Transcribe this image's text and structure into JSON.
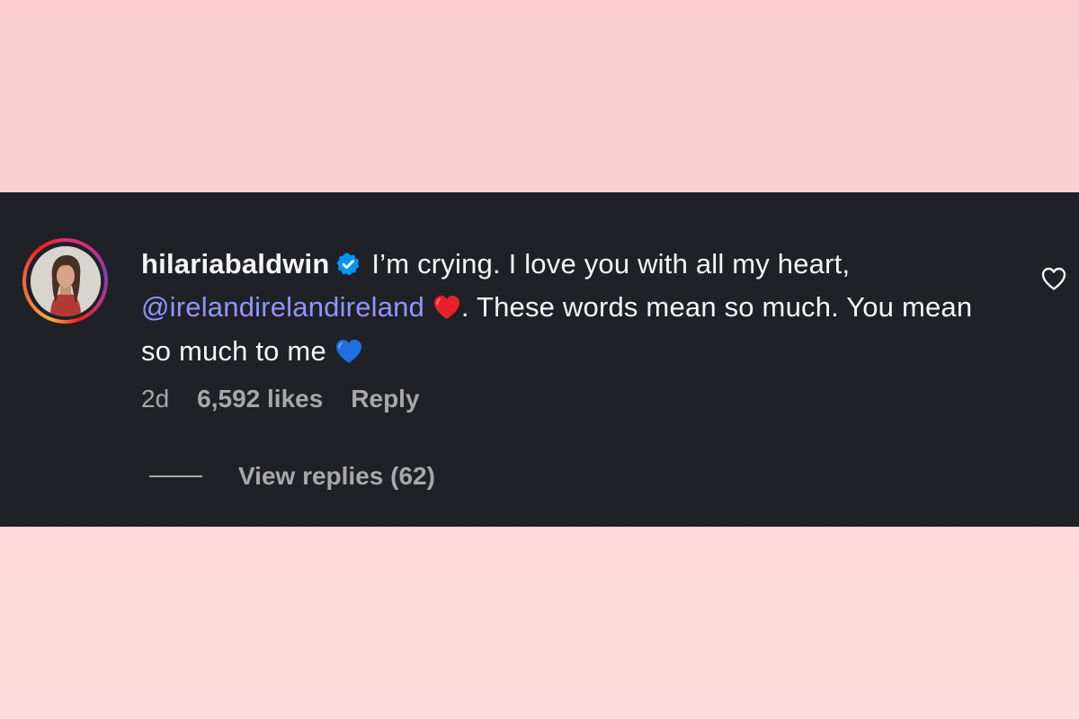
{
  "comment": {
    "username": "hilariabaldwin",
    "text_part1": "I’m crying. I love you with all my heart,",
    "mention": "@irelandirelandireland",
    "text_part2": ". These words mean so much. You mean so much to me",
    "emoji_1": "red-heart",
    "emoji_2": "blue-heart",
    "verified_icon": "verified-badge-icon",
    "avatar_icon": "profile-photo"
  },
  "meta": {
    "time": "2d",
    "likes": "6,592 likes",
    "reply_label": "Reply"
  },
  "replies": {
    "label": "View replies (62)"
  },
  "colors": {
    "background": "#f9cdd0",
    "panel": "#202127",
    "text": "#f5f5f5",
    "meta_text": "#a8a8a8",
    "mention": "#8e96ff",
    "verified": "#0095f6"
  }
}
